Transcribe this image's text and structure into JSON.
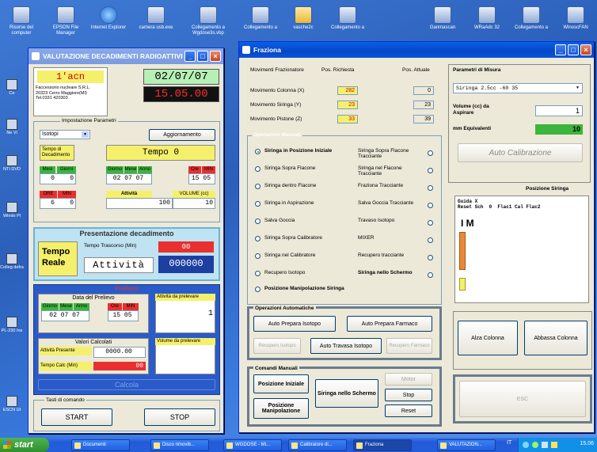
{
  "desktop_icons": [
    {
      "label": "Risorse del computer",
      "icon": "computer-icon"
    },
    {
      "label": "EPSON File Manager",
      "icon": "epson-icon"
    },
    {
      "label": "Internet Explorer",
      "icon": "ie-icon"
    },
    {
      "label": "camera usb.exe",
      "icon": "camera-icon"
    },
    {
      "label": "Collegamento a Wgdose3s.vbp",
      "icon": "shortcut-icon"
    },
    {
      "label": "Collegamento a",
      "icon": "shortcut-icon"
    },
    {
      "label": "vasche2c",
      "icon": "folder-icon"
    },
    {
      "label": "Collegamento a",
      "icon": "shortcut-icon"
    },
    {
      "label": "Ganmascan",
      "icon": "app-icon"
    },
    {
      "label": "WRaAdc 32",
      "icon": "app-icon"
    },
    {
      "label": "Collegamento a",
      "icon": "shortcut-icon"
    },
    {
      "label": "WinoscFAN",
      "icon": "app-icon"
    }
  ],
  "left_icons": [
    "Ce",
    "Ne Vi",
    "NTI DVD",
    "Windo Pl",
    "Colleg defra",
    "PL-230 Ins",
    "ESCN Ut"
  ],
  "val": {
    "title": "VALUTAZIONE DECADIMENTI RADIOATTIVI",
    "code": "1'acn",
    "company": "Faccessorio nucleare S.R.L.\n20323  Cerro Maggiore(MI)\nTel.0331 420303",
    "date": "02/07/07",
    "time": "15.05.00",
    "impostazione_title": "Impostazione Parametri",
    "isotopo_select": "Isotopi",
    "aggiornamento": "Aggiornamento",
    "tempo_decadimento": "Tempo di Decadimento",
    "tempo0": "Tempo 0",
    "h_mesi": "Mesi",
    "h_giorni": "Giorni",
    "h_giorno": "Giorno",
    "h_mese": "Mese",
    "h_anno": "Anno",
    "h_ore": "Ore",
    "h_min": "MIN",
    "v_mesi": "0",
    "v_giorni": "0",
    "v_giorno": "02",
    "v_mese": "07",
    "v_anno": "07",
    "v_ore": "15",
    "v_min": "05",
    "h_ore2": "ORE",
    "h_min2": "MIN",
    "h_attivita": "Attività",
    "h_volume": "VOLUME (cc)",
    "v_ore2": "6",
    "v_min2": "0",
    "v_attivita": "100",
    "v_volume": "10",
    "presentazione": "Presentazione decadimento",
    "tempo_reale": "Tempo Reale",
    "tempo_trascorso_lbl": "Tempo Trascorso (Min)",
    "tempo_trascorso_val": "00",
    "attivita_lbl": "Attività",
    "attivita_val": "000000",
    "prelievo_title": "Prelievo",
    "data_prelievo": "Data del Prelievo",
    "p_h_giorno": "Giorno",
    "p_h_mese": "Mese",
    "p_h_anno": "Anno",
    "p_h_ore": "Ore",
    "p_h_min": "MIN",
    "p_giorno": "02",
    "p_mese": "07",
    "p_anno": "07",
    "p_ore": "15",
    "p_min": "05",
    "attivita_da_prelevare": "Attività da prelevare",
    "attivita_da_prelevare_val": "1",
    "valori_calcolati": "Valori Calcolati",
    "attivita_presente": "Attività Presente",
    "attivita_presente_val": "0000.00",
    "tempo_calc": "Tempo Calc (Min)",
    "tempo_calc_val": "00",
    "volume_da_prelevare": "Volume da prelevare",
    "calcola": "Calcola",
    "tasti": "Tasti di comando",
    "start": "START",
    "stop": "STOP"
  },
  "fraz": {
    "title": "Fraziona",
    "h_mov": "Movimenti Frazionatore",
    "h_richiesta": "Pos. Richiesta",
    "h_attuale": "Pos. Attuale",
    "rows": [
      {
        "label": "Movimento Colonna (X)",
        "req": "282",
        "act": "0"
      },
      {
        "label": "Movimento   Siringa (Y)",
        "req": "23",
        "act": "23"
      },
      {
        "label": "Movimento  Pistone (Z)",
        "req": "33",
        "act": "39"
      }
    ],
    "manual_title": "Operazioni Manuali",
    "left_ops": [
      "Siringa in Posizione Iniziale",
      "Siringa Sopra Flacone",
      "Siringa dentro Flacone",
      "Siringa in Aspirazione",
      "Salva Goccia",
      "Siringa Sopra Calibratore",
      "Siringa nel Calibratore",
      "Recupero Isotopo",
      "Posizione Manipolazione Siringa"
    ],
    "right_ops": [
      "Siringa Sopra Flacone Tracciante",
      "Siringa nel Flacone Tracciante",
      "Fraziona Tracciante",
      "Salva Goccia Tracciante",
      "Travaso Isotopo",
      "MIXER",
      "Recupero tracciante",
      "Siringa nello Schermo"
    ],
    "auto_title": "Operazioni Automatiche",
    "auto_prepara_isotopo": "Auto Prepara Isotopo",
    "auto_prepara_farmaco": "Auto Prepara Farmaco",
    "recupero_isotopo": "Recupero Isotopo",
    "auto_travasa": "Auto Travasa Isotopo",
    "recupero_farmaco": "Recupero Farmaco",
    "cmd_title": "Comandi Manuali",
    "pos_iniziale": "Posizione Iniziale",
    "pos_manip": "Posizione Manipolazione",
    "siringa_schermo": "Siringa nello Schermo",
    "motor": "Motor",
    "stop": "Stop",
    "reset": "Reset",
    "param_title": "Parametri di Misura",
    "siringa_sel": "Siringa  2.5cc -60  35",
    "volume_lbl": "Volume (cc) da Aspirare",
    "volume_val": "1",
    "mm_lbl": "mm Equivalenti",
    "mm_val": "10",
    "auto_calibrazione": "Auto Calibrazione",
    "posizione_siringa": "Posizione Siringa",
    "guida": "Guida X",
    "grid_cols": "Reset Sch  0  Flac1 Cal Flac2",
    "im": "I M",
    "alza": "Alza Colonna",
    "abbassa": "Abbassa Colonna",
    "esc": "ESC"
  },
  "taskbar": {
    "start": "start",
    "items": [
      "Documenti",
      "Disco rimovib...",
      "WGDOSE - Mi...",
      "Calibratore di...",
      "Fraziona",
      "VALUTAZION..."
    ],
    "lang": "IT",
    "clock": "15.06"
  }
}
